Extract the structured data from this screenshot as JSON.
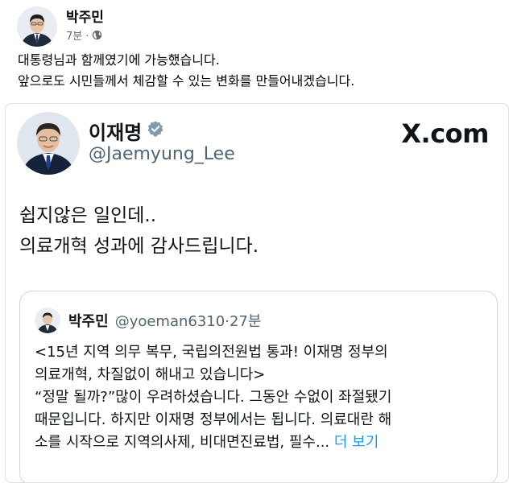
{
  "post": {
    "author": "박주민",
    "time": "7분",
    "separator": "·",
    "text_lines": [
      "대통령님과 함께였기에 가능했습니다.",
      "앞으로도 시민들께서 체감할 수 있는 변화를 만들어내겠습니다."
    ]
  },
  "tweet": {
    "name": "이재명",
    "handle": "@Jaemyung_Lee",
    "brand": "X.com",
    "body_lines": [
      "쉽지않은 일인데..",
      "의료개혁 성과에 감사드립니다."
    ]
  },
  "quoted": {
    "name": "박주민",
    "handle": "@yoeman6310",
    "separator": "·",
    "time": "27분",
    "body_lines": [
      "<15년 지역 의무 복무, 국립의전원법 통과! 이재명 정부의",
      "의료개혁, 차질없이 해내고 있습니다>",
      "“정말 될까?”많이 우려하셨습니다. 그동안 수없이 좌절됐기",
      "때문입니다. 하지만 이재명 정부에서는 됩니다. 의료대란 해"
    ],
    "last_line": "소를 시작으로 지역의사제, 비대면진료법, 필수...",
    "more": "더 보기"
  },
  "colors": {
    "meta_gray": "#65676b",
    "twitter_gray": "#536471",
    "link_blue": "#1d9bf0",
    "verified_gray": "#829aab"
  },
  "icons": {
    "privacy": "globe-icon",
    "verified": "verified-badge-icon"
  }
}
